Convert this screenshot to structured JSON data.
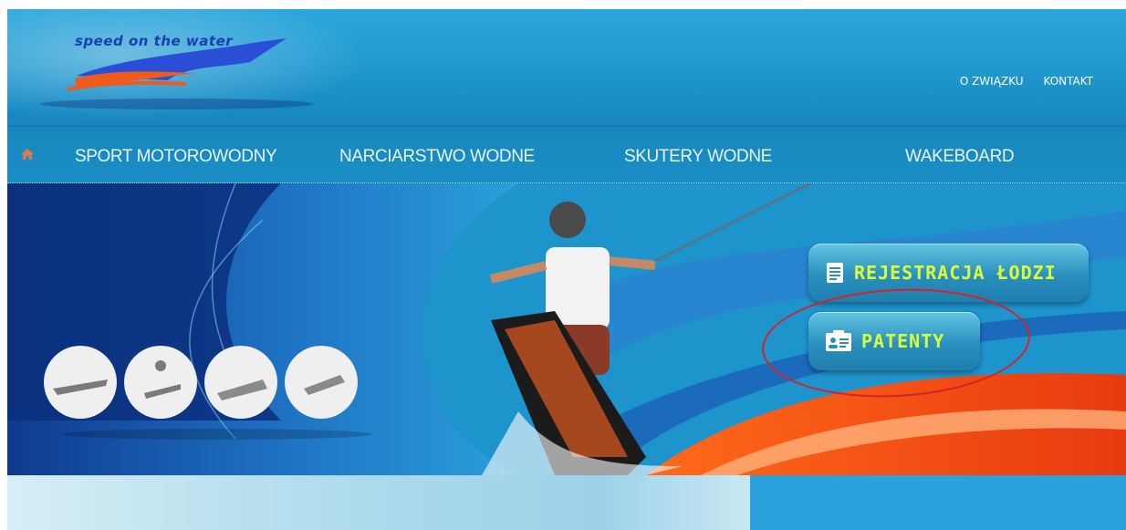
{
  "header": {
    "logo_text": "speed on the water",
    "top_links": [
      "O ZWIĄZKU",
      "KONTAKT"
    ]
  },
  "nav": {
    "home_icon": "home-icon",
    "items": [
      "SPORT MOTOROWODNY",
      "NARCIARSTWO WODNE",
      "SKUTERY WODNE",
      "WAKEBOARD"
    ]
  },
  "hero": {
    "sport_icons": [
      "jet-boat-icon",
      "water-ski-icon",
      "jet-ski-icon",
      "wakeboard-icon"
    ],
    "buttons": {
      "registration": "REJESTRACJA ŁODZI",
      "patents": "PATENTY"
    }
  },
  "colors": {
    "header_blue": "#1e95cd",
    "button_text": "#d8ff3a",
    "highlight_red": "#d4222a"
  }
}
